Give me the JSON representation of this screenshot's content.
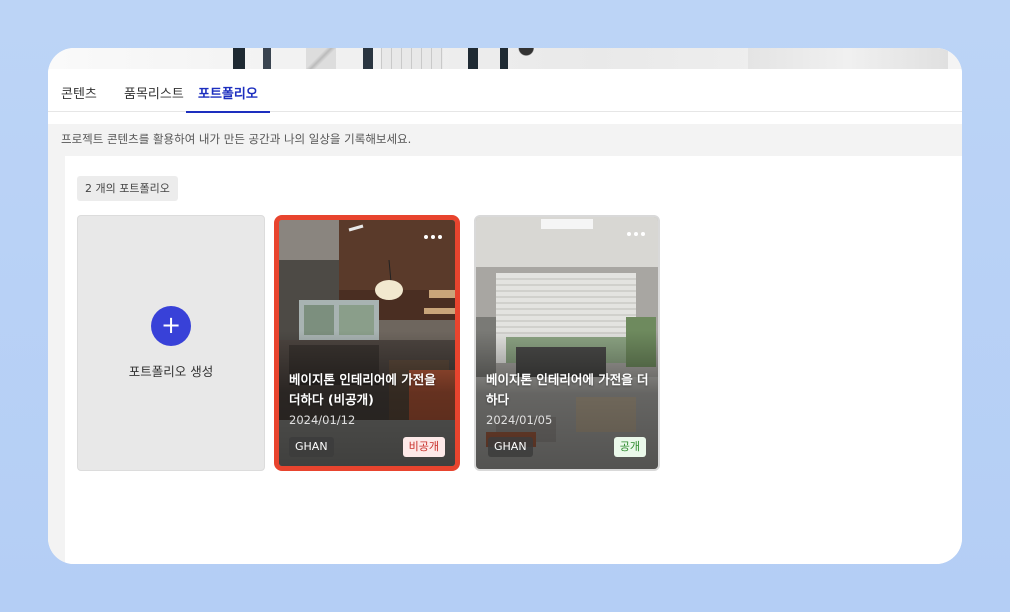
{
  "tabs": [
    {
      "label": "콘텐츠"
    },
    {
      "label": "품목리스트"
    },
    {
      "label": "포트폴리오",
      "active": true
    }
  ],
  "description": "프로젝트 콘텐츠를 활용하여 내가 만든 공간과 나의 일상을 기록해보세요.",
  "portfolio_count": "2 개의 포트폴리오",
  "create_card": {
    "label": "포트폴리오 생성",
    "icon": "plus-icon"
  },
  "cards": [
    {
      "title": "베이지톤 인테리어에 가전을 더하다 (비공개)",
      "date": "2024/01/12",
      "author": "GHAN",
      "status": "비공개",
      "selected": true,
      "menu_icon": "more-horizontal-icon"
    },
    {
      "title": "베이지톤 인테리어에 가전을 더하다",
      "date": "2024/01/05",
      "author": "GHAN",
      "status": "공개",
      "selected": false,
      "menu_icon": "more-horizontal-icon"
    }
  ],
  "colors": {
    "accent": "#1d2fbf",
    "plus_button": "#3841d8",
    "selected_border": "#e8442e",
    "private_text": "#c8302a",
    "public_text": "#2e8a2e"
  }
}
